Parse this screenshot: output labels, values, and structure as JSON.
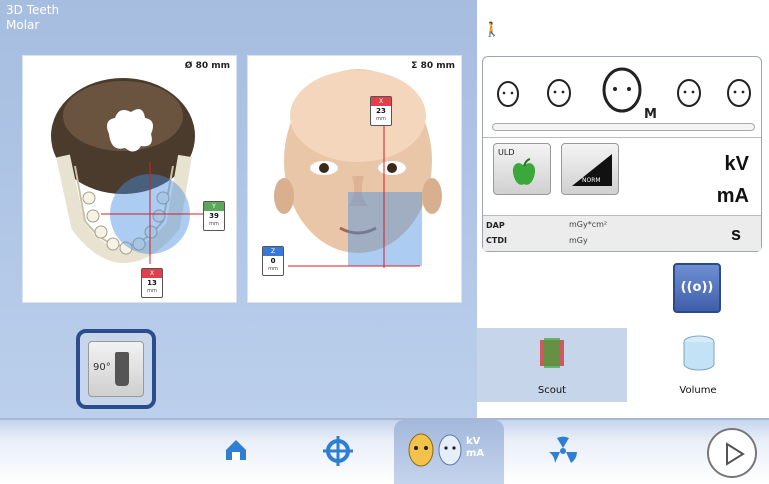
{
  "title": {
    "line1": "3D Teeth",
    "line2": "Molar"
  },
  "views": {
    "left": {
      "fov": "Ø 80 mm",
      "y_tag": {
        "value": "39",
        "unit": "mm"
      },
      "x_tag": {
        "value": "13",
        "unit": "mm"
      }
    },
    "right": {
      "fov": "Σ 80 mm",
      "x_tag": {
        "value": "23",
        "unit": "mm"
      },
      "z_tag": {
        "value": "0",
        "unit": "mm"
      }
    }
  },
  "rotate_button": {
    "label": "90°"
  },
  "params": {
    "patient_size_selected": "M",
    "uld_label": "ULD",
    "norm_label": "NORM",
    "kv_label": "kV",
    "ma_label": "mA",
    "dap_label": "DAP",
    "dap_unit": "mGy*cm²",
    "ctdi_label": "CTDI",
    "ctdi_unit": "mGy",
    "s_label": "s"
  },
  "expose_button": {
    "label": "((o))"
  },
  "modes": {
    "scout_label": "Scout",
    "volume_label": "Volume"
  },
  "bottom_nav": {
    "kv_ma_label": "kV mA"
  },
  "colors": {
    "accent": "#2b4d8c",
    "left_bg": "#a6bde0",
    "tag_red": "#e0404a",
    "tag_green": "#5aa85a",
    "tag_blue": "#3a78d6"
  }
}
